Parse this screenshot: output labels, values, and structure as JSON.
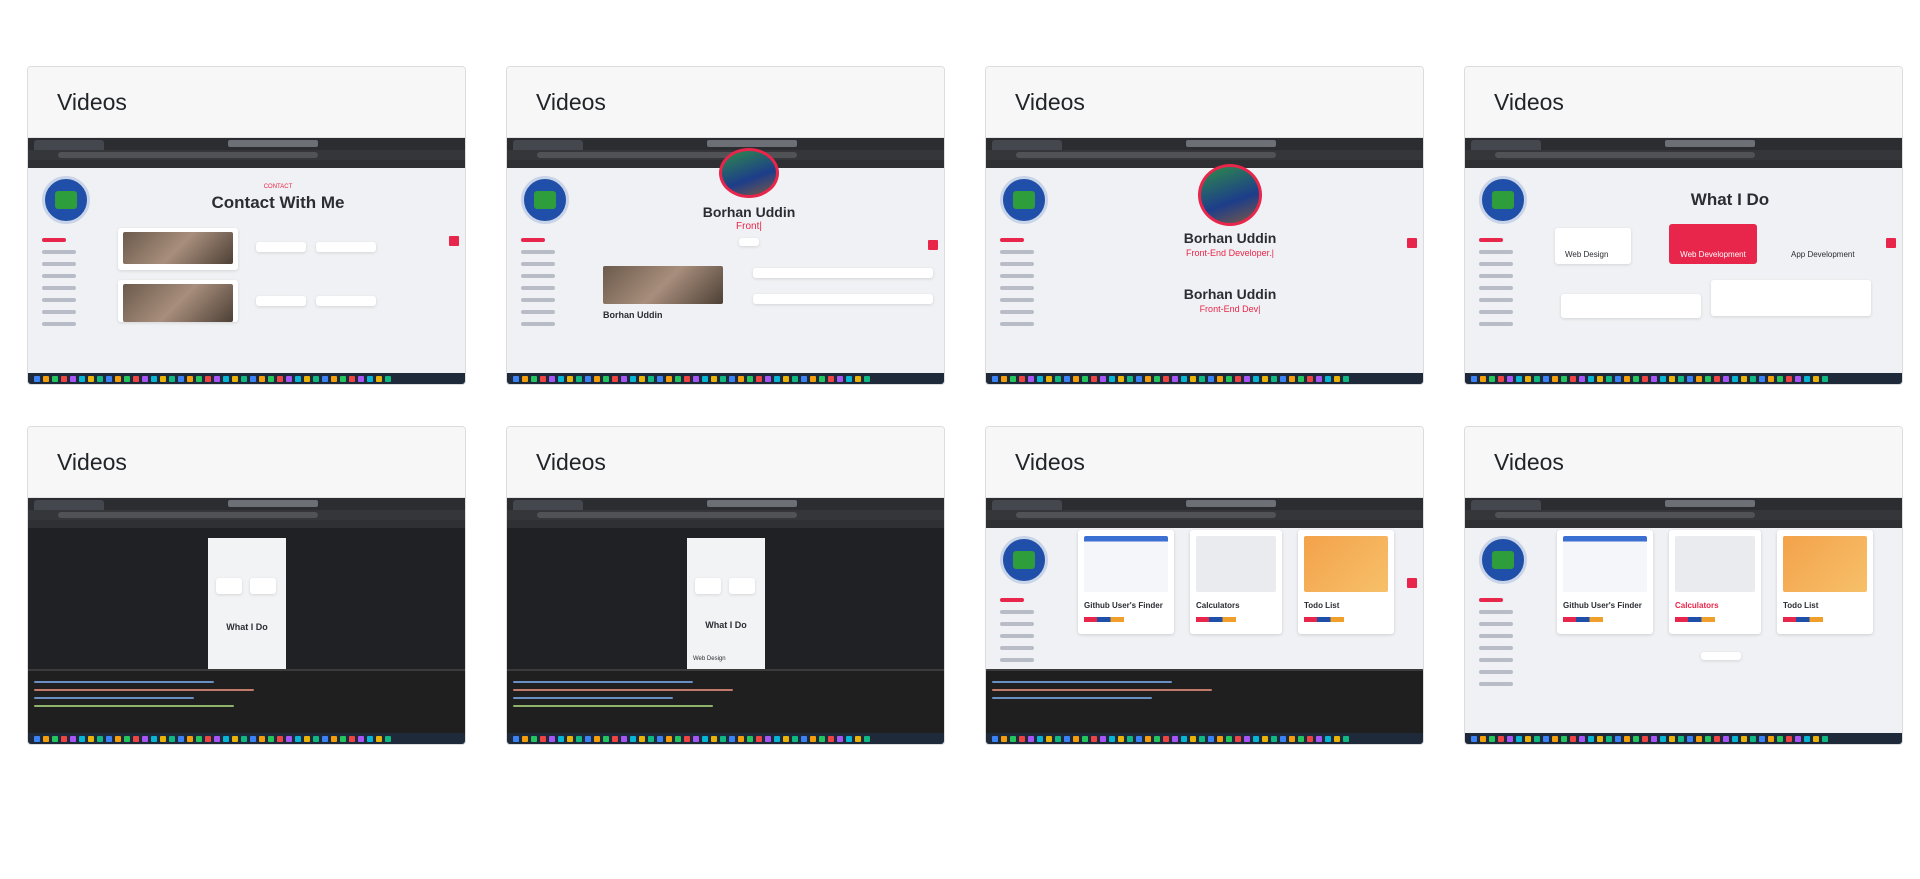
{
  "cards": [
    {
      "title": "Videos",
      "thumbnail": {
        "heading": "Contact With Me",
        "subheading": "CONTACT"
      }
    },
    {
      "title": "Videos",
      "thumbnail": {
        "heading": "Borhan Uddin",
        "subheading": "Front|",
        "caption": "Borhan Uddin"
      }
    },
    {
      "title": "Videos",
      "thumbnail": {
        "heading": "Borhan Uddin",
        "subheading": "Front-End Developer.|",
        "heading2": "Borhan Uddin",
        "subheading2": "Front-End Dev|"
      }
    },
    {
      "title": "Videos",
      "thumbnail": {
        "heading": "What I Do",
        "tiles": [
          "Web Design",
          "Web Development",
          "App Development"
        ]
      }
    },
    {
      "title": "Videos",
      "thumbnail": {
        "heading": "What I Do"
      }
    },
    {
      "title": "Videos",
      "thumbnail": {
        "heading": "What I Do",
        "tiles": [
          "Web Design"
        ]
      }
    },
    {
      "title": "Videos",
      "thumbnail": {
        "projects": [
          "Github User's Finder",
          "Calculators",
          "Todo List"
        ]
      }
    },
    {
      "title": "Videos",
      "thumbnail": {
        "projects": [
          "Github User's Finder",
          "Calculators",
          "Todo List"
        ]
      }
    }
  ],
  "colors": {
    "accent": "#e8254a",
    "brand": "#1f4fa8",
    "header_bg": "#f7f7f7"
  }
}
